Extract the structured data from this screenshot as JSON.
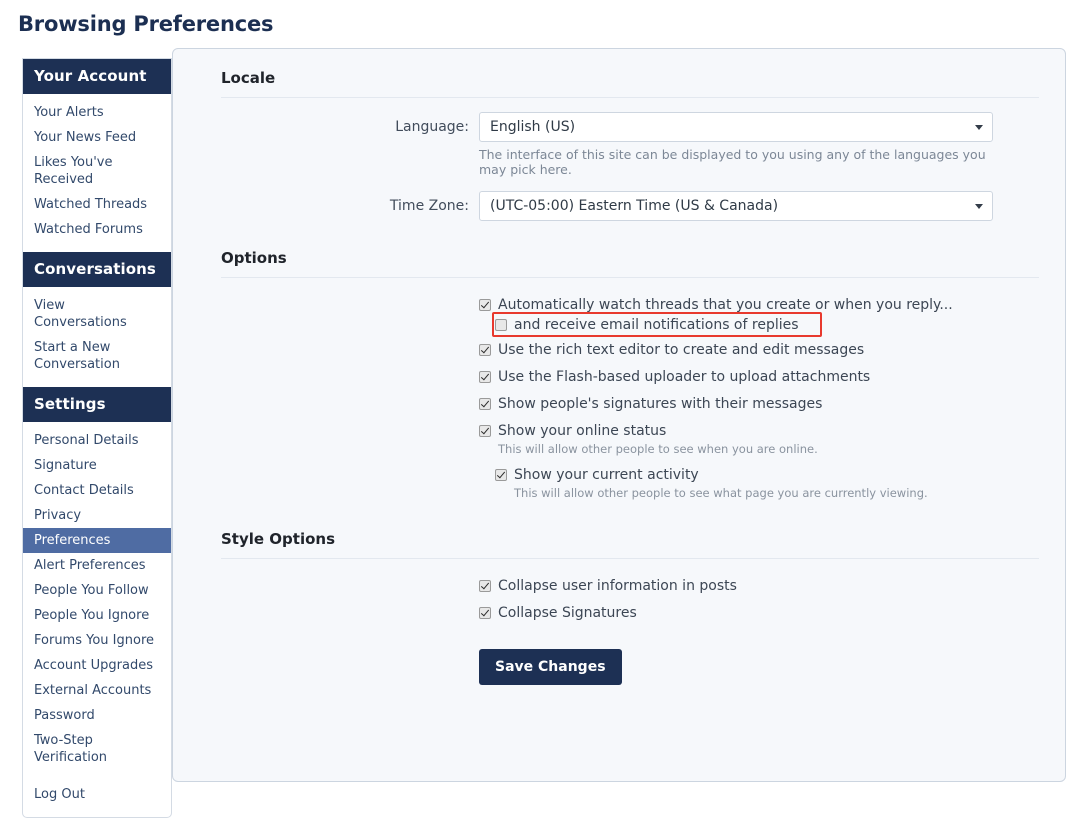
{
  "page": {
    "title": "Browsing Preferences"
  },
  "sidebar": {
    "groups": [
      {
        "header": "Your Account",
        "items": [
          {
            "label": "Your Alerts",
            "selected": false
          },
          {
            "label": "Your News Feed",
            "selected": false
          },
          {
            "label": "Likes You've Received",
            "selected": false
          },
          {
            "label": "Watched Threads",
            "selected": false
          },
          {
            "label": "Watched Forums",
            "selected": false
          }
        ]
      },
      {
        "header": "Conversations",
        "items": [
          {
            "label": "View Conversations",
            "selected": false
          },
          {
            "label": "Start a New Conversation",
            "selected": false
          }
        ]
      },
      {
        "header": "Settings",
        "items": [
          {
            "label": "Personal Details",
            "selected": false
          },
          {
            "label": "Signature",
            "selected": false
          },
          {
            "label": "Contact Details",
            "selected": false
          },
          {
            "label": "Privacy",
            "selected": false
          },
          {
            "label": "Preferences",
            "selected": true
          },
          {
            "label": "Alert Preferences",
            "selected": false
          },
          {
            "label": "People You Follow",
            "selected": false
          },
          {
            "label": "People You Ignore",
            "selected": false
          },
          {
            "label": "Forums You Ignore",
            "selected": false
          },
          {
            "label": "Account Upgrades",
            "selected": false
          },
          {
            "label": "External Accounts",
            "selected": false
          },
          {
            "label": "Password",
            "selected": false
          },
          {
            "label": "Two-Step Verification",
            "selected": false
          },
          {
            "label": "Log Out",
            "selected": false
          }
        ]
      }
    ]
  },
  "locale": {
    "section_title": "Locale",
    "language": {
      "label": "Language:",
      "value": "English (US)",
      "hint": "The interface of this site can be displayed to you using any of the languages you may pick here."
    },
    "timezone": {
      "label": "Time Zone:",
      "value": "(UTC-05:00) Eastern Time (US & Canada)"
    }
  },
  "options": {
    "section_title": "Options",
    "items": {
      "auto_watch": {
        "label": "Automatically watch threads that you create or when you reply...",
        "checked": true
      },
      "email_notifications": {
        "label": "and receive email notifications of replies",
        "checked": false,
        "highlighted": true
      },
      "rich_text_editor": {
        "label": "Use the rich text editor to create and edit messages",
        "checked": true
      },
      "flash_uploader": {
        "label": "Use the Flash-based uploader to upload attachments",
        "checked": true
      },
      "show_signatures": {
        "label": "Show people's signatures with their messages",
        "checked": true
      },
      "online_status": {
        "label": "Show your online status",
        "checked": true,
        "hint": "This will allow other people to see when you are online."
      },
      "current_activity": {
        "label": "Show your current activity",
        "checked": true,
        "hint": "This will allow other people to see what page you are currently viewing."
      }
    }
  },
  "style_options": {
    "section_title": "Style Options",
    "items": {
      "collapse_user_info": {
        "label": "Collapse user information in posts",
        "checked": true
      },
      "collapse_signatures": {
        "label": "Collapse Signatures",
        "checked": true
      }
    }
  },
  "actions": {
    "save_label": "Save Changes"
  },
  "colors": {
    "header_navy": "#1d3054",
    "selected_blue": "#4f6ca3",
    "panel_bg": "#f6f8fb",
    "highlight_red": "#e8392e",
    "title_navy": "#1c2f52"
  }
}
